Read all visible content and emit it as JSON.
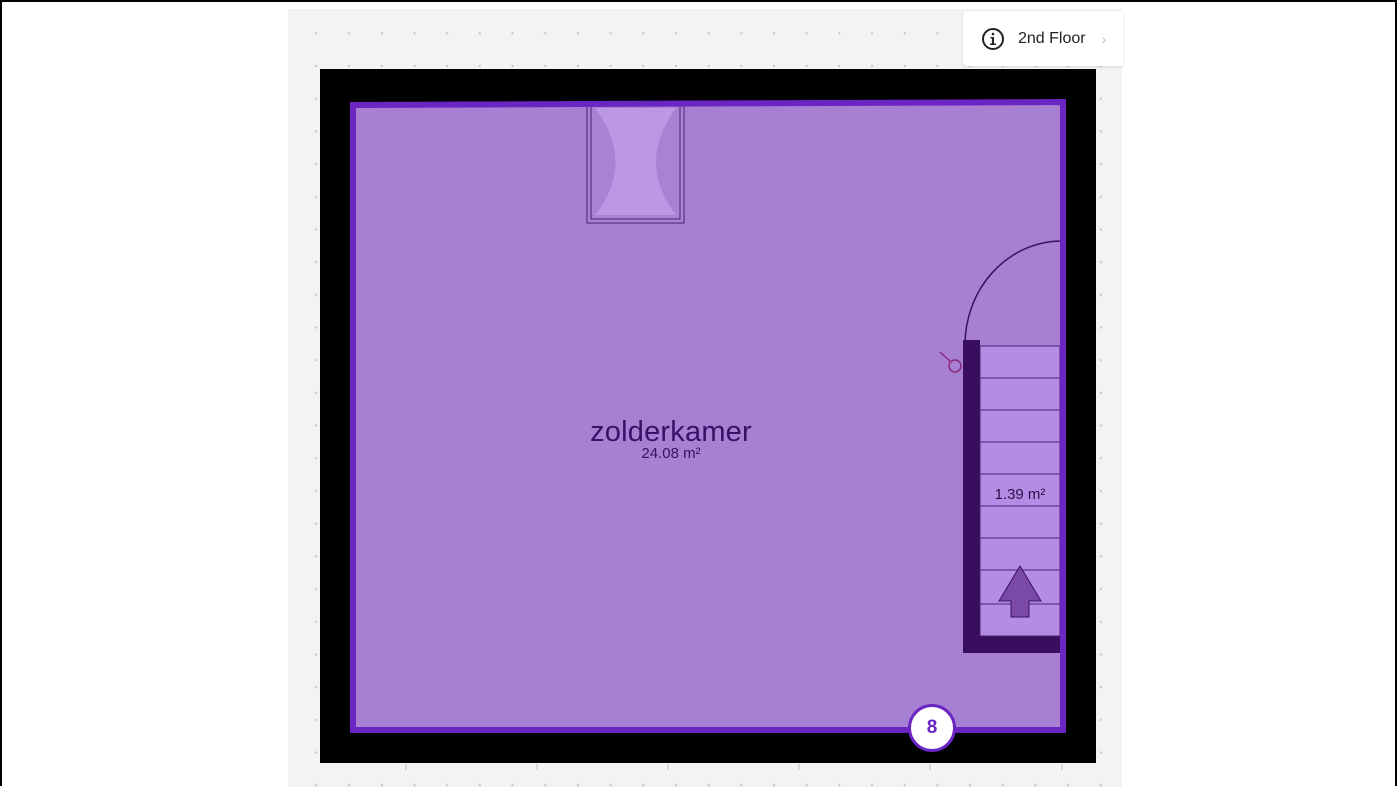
{
  "floor_selector": {
    "label": "2nd Floor",
    "chevron": "›",
    "icon": "info-icon"
  },
  "rooms": [
    {
      "name": "zolderkamer",
      "area": "24.08 m²"
    },
    {
      "name": "",
      "area": "1.39 m²"
    }
  ],
  "badge": {
    "number": "8"
  },
  "colors": {
    "room_fill": "#a77fd3",
    "room_border": "#6b25c3",
    "wall": "#000000",
    "stair_wall": "#3b0d5e",
    "canvas": "#f3f3f3"
  }
}
